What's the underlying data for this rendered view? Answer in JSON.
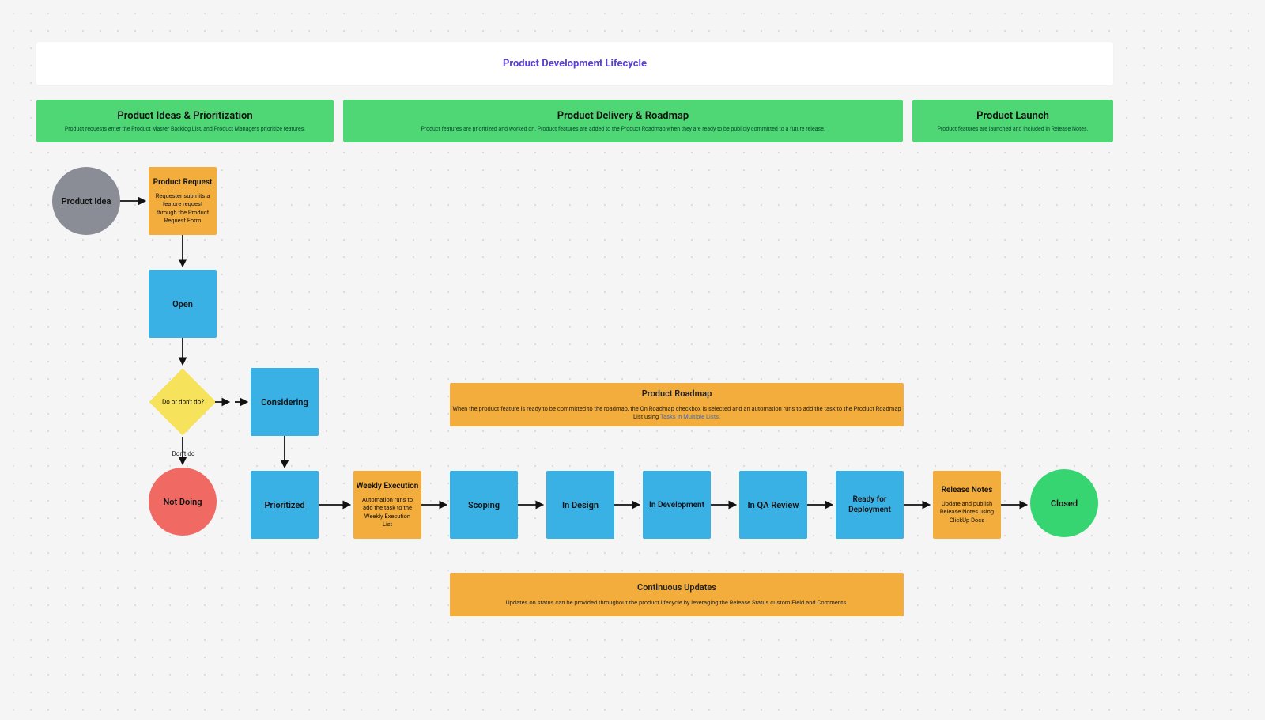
{
  "title": "Product Development Lifecycle",
  "phases": {
    "ideas": {
      "header": "Product Ideas & Prioritization",
      "sub": "Product requests enter the Product Master Backlog List, and Product Managers prioritize features."
    },
    "delivery": {
      "header": "Product Delivery & Roadmap",
      "sub": "Product features are prioritized and worked on. Product features are added to the Product Roadmap when they are ready to be publicly committed to a future release."
    },
    "launch": {
      "header": "Product Launch",
      "sub": "Product features are launched and included in Release Notes."
    }
  },
  "nodes": {
    "product_idea": "Product Idea",
    "product_request": {
      "title": "Product Request",
      "sub": "Requester submits a feature request through the Product Request Form"
    },
    "open": "Open",
    "decision": "Do or don't do?",
    "decision_dont": "Don't do",
    "not_doing": "Not Doing",
    "considering": "Considering",
    "prioritized": "Prioritized",
    "weekly": {
      "title": "Weekly Execution",
      "sub": "Automation runs to add the task to the Weekly Execution List"
    },
    "scoping": "Scoping",
    "in_design": "In Design",
    "in_dev": "In Development",
    "in_qa": "In QA Review",
    "ready_deploy": "Ready for Deployment",
    "release_notes": {
      "title": "Release Notes",
      "sub": "Update and publish Release Notes using ClickUp Docs"
    },
    "closed": "Closed"
  },
  "banners": {
    "roadmap": {
      "title": "Product Roadmap",
      "sub": "When the product feature is ready to be committed to the roadmap, the On Roadmap checkbox is selected and an automation runs to add the task to the Product Roadmap List using ",
      "link": "Tasks in Multiple Lists"
    },
    "updates": {
      "title": "Continuous Updates",
      "sub": "Updates on status can be provided throughout the product lifecycle by leveraging the Release Status custom Field and Comments."
    }
  },
  "colors": {
    "green": "#4fd675",
    "orange": "#f3ad3d",
    "blue": "#39b1e5",
    "yellow": "#f7e35b",
    "red": "#f06a63",
    "gray": "#8a8d95",
    "closedGreen": "#37d472"
  }
}
